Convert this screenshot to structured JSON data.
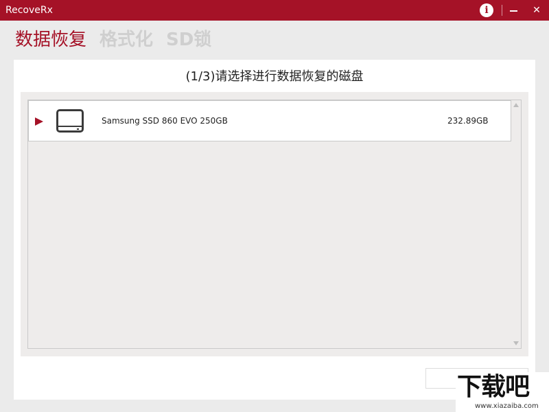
{
  "app": {
    "title": "RecoveRx"
  },
  "titlebar": {
    "info_icon": "i",
    "close_icon": "✕"
  },
  "nav": {
    "tabs": [
      {
        "label": "数据恢复",
        "active": true
      },
      {
        "label": "格式化",
        "active": false
      },
      {
        "label": "SD锁",
        "active": false
      }
    ]
  },
  "main": {
    "step_title": "(1/3)请选择进行数据恢复的磁盘",
    "disks": [
      {
        "name": "Samsung SSD 860 EVO 250GB",
        "size": "232.89GB"
      }
    ]
  },
  "watermark": {
    "main": "下载吧",
    "sub": "www.xiazaiba.com"
  },
  "colors": {
    "accent": "#a51227",
    "inactive_tab": "#cfcfcf",
    "list_bg": "#eeeceb"
  }
}
